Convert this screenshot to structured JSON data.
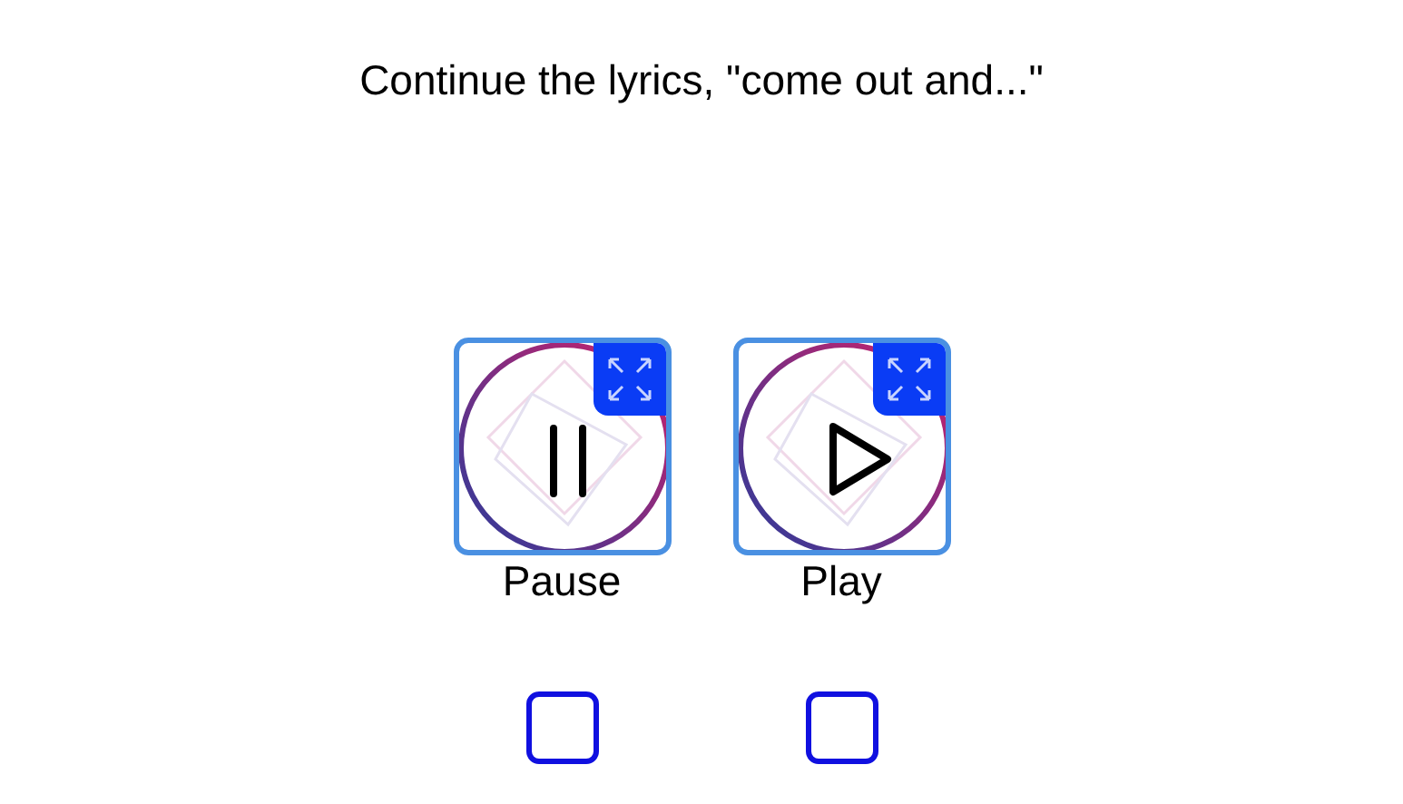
{
  "question": "Continue the lyrics, \"come out and...\"",
  "options": [
    {
      "kind": "pause",
      "label": "Pause",
      "checked": false
    },
    {
      "kind": "play",
      "label": "Play",
      "checked": false
    }
  ]
}
